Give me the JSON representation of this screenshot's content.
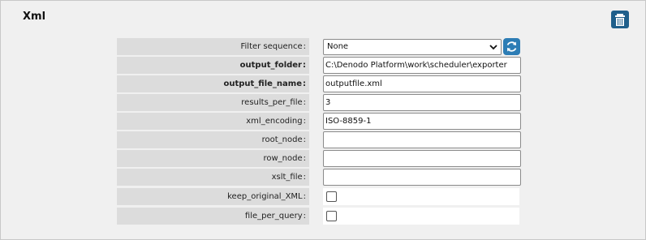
{
  "panel": {
    "title": "Xml"
  },
  "filter_sequence": {
    "label": "Filter sequence",
    "value": "None"
  },
  "fields": [
    {
      "label": "output_folder",
      "value": "C:\\Denodo Platform\\work\\scheduler\\exporter"
    },
    {
      "label": "output_file_name",
      "value": "outputfile.xml"
    },
    {
      "label": "results_per_file",
      "value": "3"
    },
    {
      "label": "xml_encoding",
      "value": "ISO-8859-1"
    },
    {
      "label": "root_node",
      "value": ""
    },
    {
      "label": "row_node",
      "value": ""
    },
    {
      "label": "xslt_file",
      "value": ""
    }
  ],
  "checkboxes": [
    {
      "label": "keep_original_XML",
      "checked": false
    },
    {
      "label": "file_per_query",
      "checked": false
    }
  ],
  "colors": {
    "panel_bg": "#f0f0f0",
    "label_bg": "#dcdcdc",
    "delete_button": "#1f5f8b",
    "refresh_button": "#2d7db5"
  },
  "icons": {
    "delete": "trash-icon",
    "refresh": "refresh-icon",
    "dropdown": "chevron-down-icon"
  }
}
